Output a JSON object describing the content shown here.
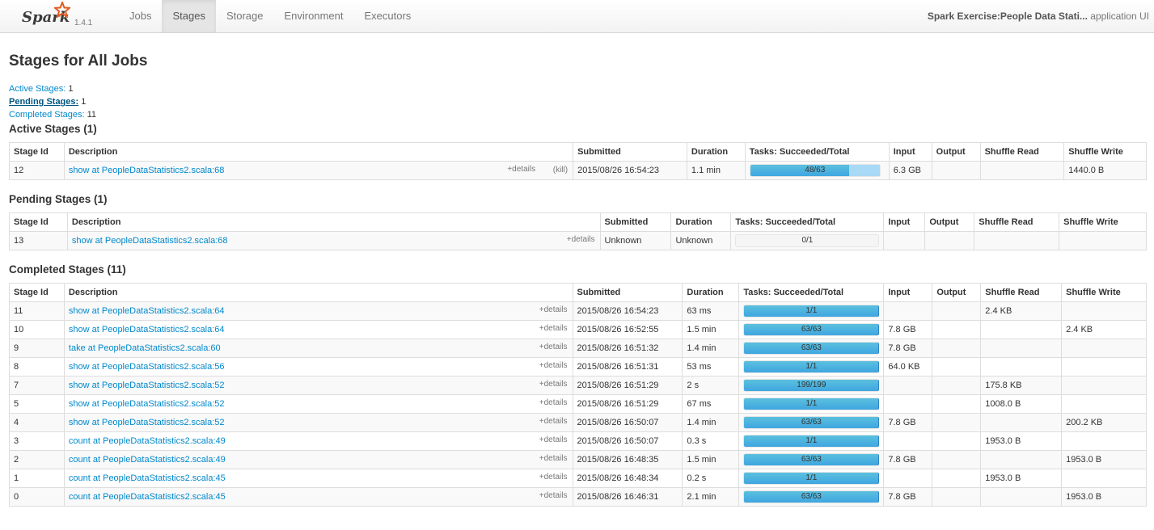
{
  "nav": {
    "brand": "Spark",
    "version": "1.4.1",
    "tabs": [
      "Jobs",
      "Stages",
      "Storage",
      "Environment",
      "Executors"
    ],
    "active_tab": "Stages",
    "app_name": "Spark Exercise:People Data Stati...",
    "app_suffix": "application UI"
  },
  "page": {
    "title": "Stages for All Jobs",
    "summary": {
      "active_label": "Active Stages:",
      "active_count": "1",
      "pending_label": "Pending Stages:",
      "pending_count": "1",
      "completed_label": "Completed Stages:",
      "completed_count": "11"
    }
  },
  "columns": [
    "Stage Id",
    "Description",
    "Submitted",
    "Duration",
    "Tasks: Succeeded/Total",
    "Input",
    "Output",
    "Shuffle Read",
    "Shuffle Write"
  ],
  "links": {
    "details": "+details",
    "kill": "(kill)"
  },
  "active": {
    "heading": "Active Stages (1)",
    "rows": [
      {
        "id": "12",
        "desc": "show at PeopleDataStatistics2.scala:68",
        "submitted": "2015/08/26 16:54:23",
        "duration": "1.1 min",
        "tasks": "48/63",
        "succeeded": 48,
        "total": 63,
        "running": 15,
        "input": "6.3 GB",
        "output": "",
        "shuffle_read": "",
        "shuffle_write": "1440.0 B"
      }
    ]
  },
  "pending": {
    "heading": "Pending Stages (1)",
    "rows": [
      {
        "id": "13",
        "desc": "show at PeopleDataStatistics2.scala:68",
        "submitted": "Unknown",
        "duration": "Unknown",
        "tasks": "0/1",
        "succeeded": 0,
        "total": 1,
        "running": 0,
        "input": "",
        "output": "",
        "shuffle_read": "",
        "shuffle_write": ""
      }
    ]
  },
  "completed": {
    "heading": "Completed Stages (11)",
    "rows": [
      {
        "id": "11",
        "desc": "show at PeopleDataStatistics2.scala:64",
        "submitted": "2015/08/26 16:54:23",
        "duration": "63 ms",
        "tasks": "1/1",
        "succeeded": 1,
        "total": 1,
        "input": "",
        "output": "",
        "shuffle_read": "2.4 KB",
        "shuffle_write": ""
      },
      {
        "id": "10",
        "desc": "show at PeopleDataStatistics2.scala:64",
        "submitted": "2015/08/26 16:52:55",
        "duration": "1.5 min",
        "tasks": "63/63",
        "succeeded": 63,
        "total": 63,
        "input": "7.8 GB",
        "output": "",
        "shuffle_read": "",
        "shuffle_write": "2.4 KB"
      },
      {
        "id": "9",
        "desc": "take at PeopleDataStatistics2.scala:60",
        "submitted": "2015/08/26 16:51:32",
        "duration": "1.4 min",
        "tasks": "63/63",
        "succeeded": 63,
        "total": 63,
        "input": "7.8 GB",
        "output": "",
        "shuffle_read": "",
        "shuffle_write": ""
      },
      {
        "id": "8",
        "desc": "show at PeopleDataStatistics2.scala:56",
        "submitted": "2015/08/26 16:51:31",
        "duration": "53 ms",
        "tasks": "1/1",
        "succeeded": 1,
        "total": 1,
        "input": "64.0 KB",
        "output": "",
        "shuffle_read": "",
        "shuffle_write": ""
      },
      {
        "id": "7",
        "desc": "show at PeopleDataStatistics2.scala:52",
        "submitted": "2015/08/26 16:51:29",
        "duration": "2 s",
        "tasks": "199/199",
        "succeeded": 199,
        "total": 199,
        "input": "",
        "output": "",
        "shuffle_read": "175.8 KB",
        "shuffle_write": ""
      },
      {
        "id": "5",
        "desc": "show at PeopleDataStatistics2.scala:52",
        "submitted": "2015/08/26 16:51:29",
        "duration": "67 ms",
        "tasks": "1/1",
        "succeeded": 1,
        "total": 1,
        "input": "",
        "output": "",
        "shuffle_read": "1008.0 B",
        "shuffle_write": ""
      },
      {
        "id": "4",
        "desc": "show at PeopleDataStatistics2.scala:52",
        "submitted": "2015/08/26 16:50:07",
        "duration": "1.4 min",
        "tasks": "63/63",
        "succeeded": 63,
        "total": 63,
        "input": "7.8 GB",
        "output": "",
        "shuffle_read": "",
        "shuffle_write": "200.2 KB"
      },
      {
        "id": "3",
        "desc": "count at PeopleDataStatistics2.scala:49",
        "submitted": "2015/08/26 16:50:07",
        "duration": "0.3 s",
        "tasks": "1/1",
        "succeeded": 1,
        "total": 1,
        "input": "",
        "output": "",
        "shuffle_read": "1953.0 B",
        "shuffle_write": ""
      },
      {
        "id": "2",
        "desc": "count at PeopleDataStatistics2.scala:49",
        "submitted": "2015/08/26 16:48:35",
        "duration": "1.5 min",
        "tasks": "63/63",
        "succeeded": 63,
        "total": 63,
        "input": "7.8 GB",
        "output": "",
        "shuffle_read": "",
        "shuffle_write": "1953.0 B"
      },
      {
        "id": "1",
        "desc": "count at PeopleDataStatistics2.scala:45",
        "submitted": "2015/08/26 16:48:34",
        "duration": "0.2 s",
        "tasks": "1/1",
        "succeeded": 1,
        "total": 1,
        "input": "",
        "output": "",
        "shuffle_read": "1953.0 B",
        "shuffle_write": ""
      },
      {
        "id": "0",
        "desc": "count at PeopleDataStatistics2.scala:45",
        "submitted": "2015/08/26 16:46:31",
        "duration": "2.1 min",
        "tasks": "63/63",
        "succeeded": 63,
        "total": 63,
        "input": "7.8 GB",
        "output": "",
        "shuffle_read": "",
        "shuffle_write": "1953.0 B"
      }
    ]
  }
}
